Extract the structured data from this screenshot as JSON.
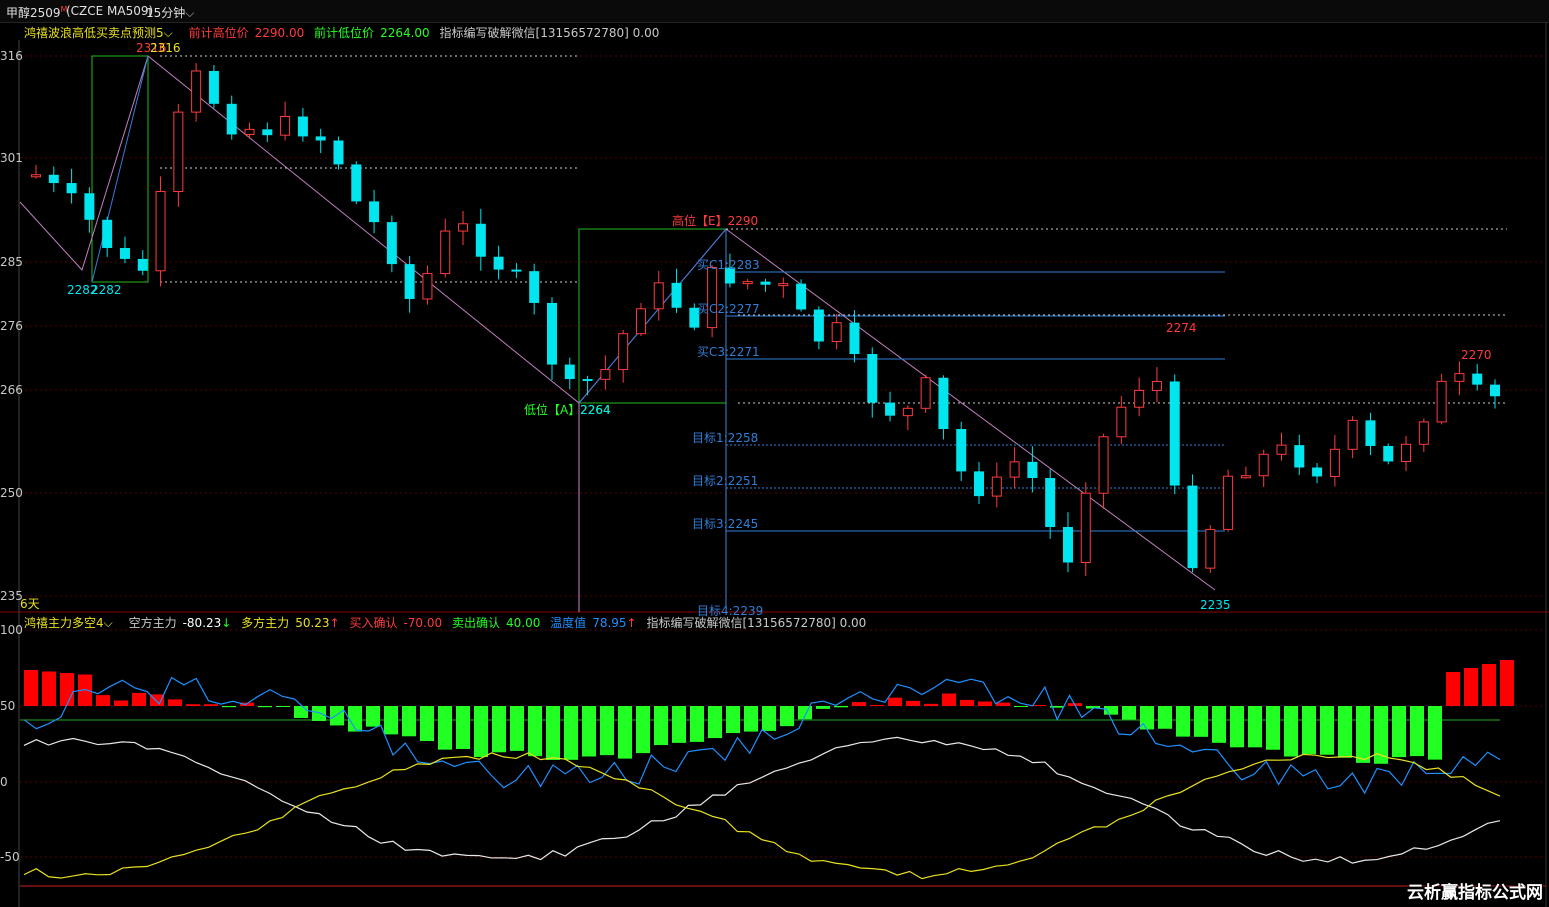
{
  "header": {
    "symbol": "甲醇2509",
    "superscript": "M",
    "code": "(CZCE MA509)",
    "period": "15分钟"
  },
  "upper_panel": {
    "indicator_name": "鸿禧波浪高低买卖点预测5",
    "prev_high_label": "前计高位价",
    "prev_high_value": "2290.00",
    "prev_low_label": "前计低位价",
    "prev_low_value": "2264.00",
    "author_note": "指标编写破解微信[13156572780] 0.00",
    "corner_label": "6天",
    "y_tick_labels": [
      "316",
      "301",
      "285",
      "276",
      "266",
      "250",
      "235"
    ],
    "annotations": {
      "peak1": "2316",
      "peak1b": "2316",
      "low1a": "2282",
      "low1b": "2282",
      "high_label": "高位【E】2290",
      "low_label": "低位【A】2264",
      "low_value": "2264",
      "buy_c1": "买C1:2283",
      "buy_c2": "买C2:2277",
      "buy_c3": "买C3:2271",
      "target1": "目标1:2258",
      "target2": "目标2:2251",
      "target3": "目标3:2245",
      "target4": "目标4:2239",
      "peak2": "2274",
      "low2": "2235",
      "peak3": "2270"
    }
  },
  "lower_panel": {
    "indicator_name": "鸿禧主力多空4",
    "bear_label": "空方主力",
    "bear_value": "-80.23",
    "bull_label": "多方主力",
    "bull_value": "50.23",
    "buy_confirm_label": "买入确认",
    "buy_confirm_value": "-70.00",
    "sell_confirm_label": "卖出确认",
    "sell_confirm_value": "40.00",
    "temp_label": "温度值",
    "temp_value": "78.95",
    "author_note": "指标编写破解微信[13156572780] 0.00",
    "y_tick_labels": [
      "100",
      "50",
      "0",
      "-50"
    ]
  },
  "watermark": "云析赢指标公式网",
  "colors": {
    "up": "#ff3b3b",
    "down": "#00e5ee",
    "bar_red": "#ff0000",
    "bar_green": "#22ff22",
    "line_blue": "#1e90ff",
    "line_white": "#e8e8e8",
    "line_yellow": "#e8e020"
  }
}
